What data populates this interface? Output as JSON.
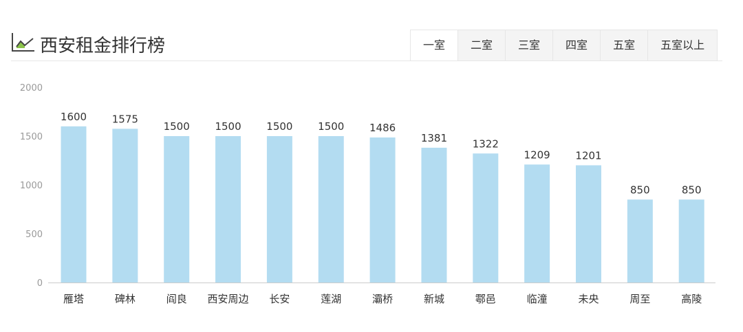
{
  "header": {
    "title": "西安租金排行榜",
    "icon": "line-chart-icon"
  },
  "tabs": [
    {
      "label": "一室",
      "active": true
    },
    {
      "label": "二室"
    },
    {
      "label": "三室"
    },
    {
      "label": "四室"
    },
    {
      "label": "五室"
    },
    {
      "label": "五室以上"
    }
  ],
  "colors": {
    "bar": "#b3dcf1",
    "axis": "#999999",
    "text": "#333333"
  },
  "chart_data": {
    "type": "bar",
    "title": "西安租金排行榜",
    "categories": [
      "雁塔",
      "碑林",
      "阎良",
      "西安周边",
      "长安",
      "莲湖",
      "灞桥",
      "新城",
      "鄠邑",
      "临潼",
      "未央",
      "周至",
      "高陵"
    ],
    "values": [
      1600,
      1575,
      1500,
      1500,
      1500,
      1500,
      1486,
      1381,
      1322,
      1209,
      1201,
      850,
      850
    ],
    "ylim": [
      0,
      2000
    ],
    "yticks": [
      0,
      500,
      1000,
      1500,
      2000
    ],
    "xlabel": "",
    "ylabel": "",
    "grid": false
  }
}
